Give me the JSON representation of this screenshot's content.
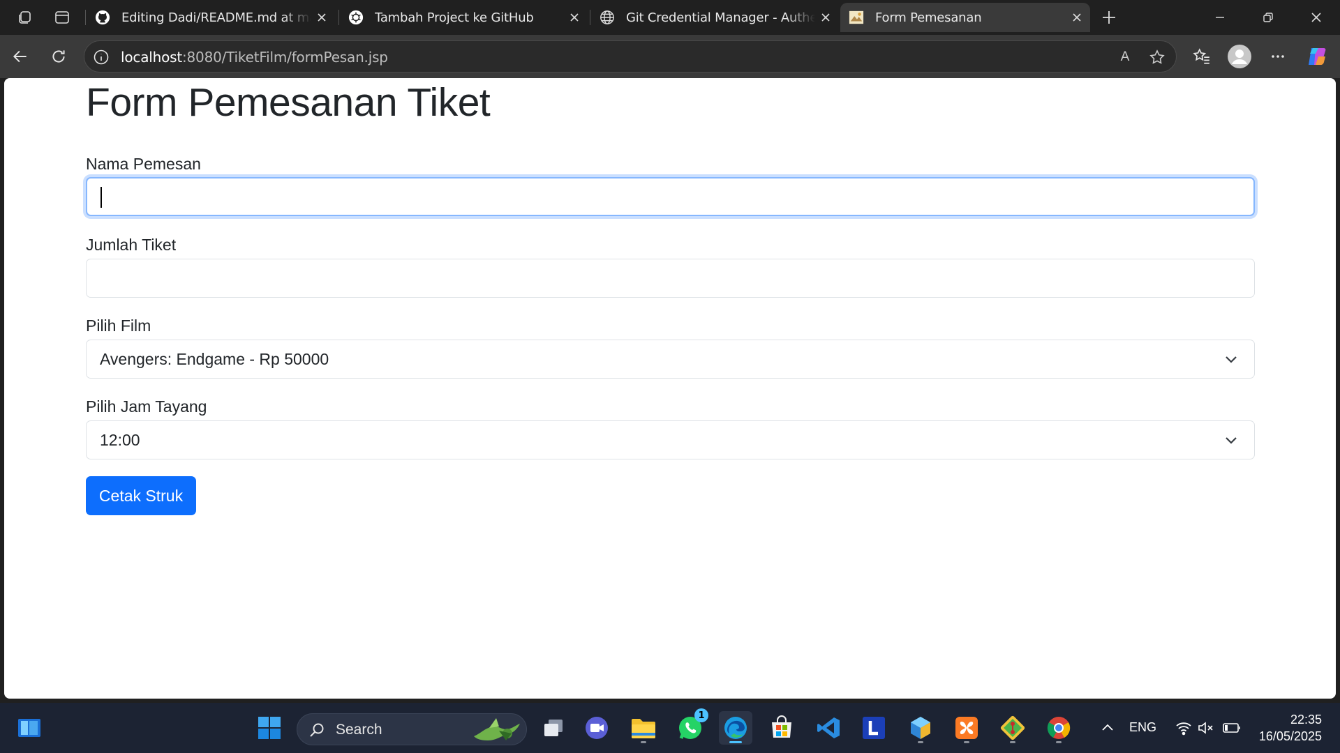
{
  "browser": {
    "tabs": [
      {
        "title": "Editing Dadi/README.md at main",
        "icon": "github-icon"
      },
      {
        "title": "Tambah Project ke GitHub",
        "icon": "openai-icon"
      },
      {
        "title": "Git Credential Manager - Authentication",
        "icon": "globe-icon"
      },
      {
        "title": "Form Pemesanan",
        "icon": "page-favicon",
        "active": true
      }
    ],
    "url_host": "localhost",
    "url_path": ":8080/TiketFilm/formPesan.jsp",
    "read_aloud_label": "A"
  },
  "page": {
    "title": "Form Pemesanan Tiket",
    "fields": {
      "nama": {
        "label": "Nama Pemesan",
        "value": ""
      },
      "jumlah": {
        "label": "Jumlah Tiket",
        "value": ""
      },
      "film": {
        "label": "Pilih Film",
        "selected": "Avengers: Endgame - Rp 50000"
      },
      "jam": {
        "label": "Pilih Jam Tayang",
        "selected": "12:00"
      }
    },
    "submit_label": "Cetak Struk"
  },
  "taskbar": {
    "search_label": "Search",
    "whatsapp_badge": "1",
    "language": "ENG",
    "time": "22:35",
    "date": "16/05/2025"
  },
  "colors": {
    "primary": "#0d6efd",
    "focus_ring": "#86b7fe",
    "browser_frame": "#202020",
    "taskbar": "#1c2333"
  }
}
